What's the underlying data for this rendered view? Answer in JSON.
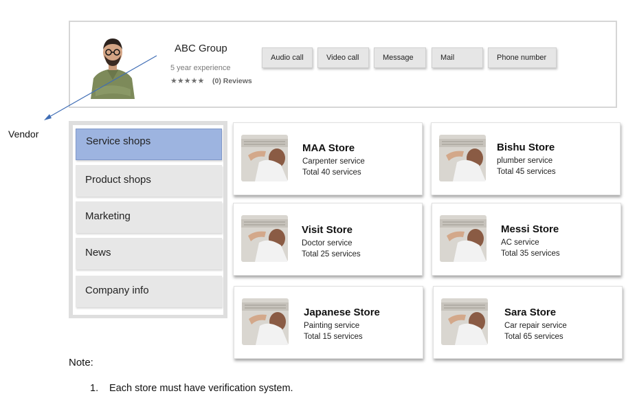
{
  "vendor": {
    "name": "ABC Group",
    "experience": "5 year experience",
    "stars": "★★★★★",
    "reviews": "(0) Reviews",
    "annotation_label": "Vendor"
  },
  "actions": [
    {
      "label": "Audio call"
    },
    {
      "label": "Video call"
    },
    {
      "label": "Message"
    },
    {
      "label": "Mail"
    },
    {
      "label": "Phone number"
    }
  ],
  "sidebar": {
    "items": [
      {
        "label": "Service shops",
        "active": true
      },
      {
        "label": "Product shops"
      },
      {
        "label": "Marketing"
      },
      {
        "label": "News"
      },
      {
        "label": "Company info"
      }
    ]
  },
  "stores": [
    {
      "name": "MAA Store",
      "service": "Carpenter service",
      "total": "Total 40 services"
    },
    {
      "name": "Bishu Store",
      "service": "plumber service",
      "total": "Total 45 services"
    },
    {
      "name": "Visit Store",
      "service": "Doctor service",
      "total": "Total 25 services"
    },
    {
      "name": "Messi Store",
      "service": "AC service",
      "total": "Total 35 services"
    },
    {
      "name": "Japanese Store",
      "service": "Painting service",
      "total": "Total 15 services"
    },
    {
      "name": "Sara Store",
      "service": "Car repair service",
      "total": "Total 65 services"
    }
  ],
  "note": {
    "title": "Note:",
    "items": [
      {
        "number": "1.",
        "text": "Each store must have verification system."
      }
    ]
  },
  "colors": {
    "active_sidebar": "#9db4e0",
    "button_bg": "#e6e6e6",
    "arrow": "#3f6db5"
  }
}
